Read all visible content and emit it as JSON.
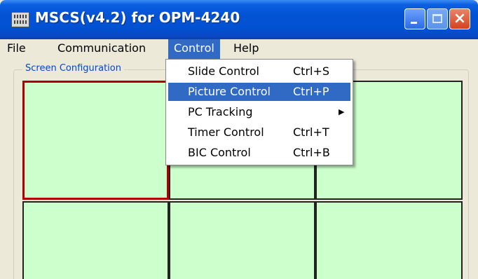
{
  "window": {
    "title": "MSCS(v4.2) for OPM-4240",
    "controls": {
      "minimize": "minimize",
      "maximize": "maximize",
      "close": "×"
    }
  },
  "menubar": {
    "items": [
      {
        "label": "File"
      },
      {
        "label": "Communication"
      },
      {
        "label": "Control",
        "active": true
      },
      {
        "label": "Help"
      }
    ]
  },
  "group": {
    "label": "Screen Configuration"
  },
  "dropdown": {
    "items": [
      {
        "label": "Slide Control",
        "mnemonic": "S",
        "shortcut": "Ctrl+S"
      },
      {
        "label": "Picture Control",
        "mnemonic": "P",
        "shortcut": "Ctrl+P",
        "highlighted": true
      },
      {
        "label": "PC Tracking",
        "shortcut": "",
        "submenu": true
      },
      {
        "label": "Timer Control",
        "mnemonic": "T",
        "shortcut": "Ctrl+T"
      },
      {
        "label": "BIC Control",
        "mnemonic": "B",
        "shortcut": "Ctrl+B"
      }
    ]
  },
  "screens": {
    "rows": 2,
    "cols": 3,
    "selected_index": 0,
    "fill_color": "#ccffcc",
    "selected_border_color": "#b00000"
  },
  "colors": {
    "titlebar_blue": "#0352d4",
    "menu_highlight": "#316ac5",
    "group_label": "#0046d5",
    "window_bg": "#ece9d8"
  }
}
